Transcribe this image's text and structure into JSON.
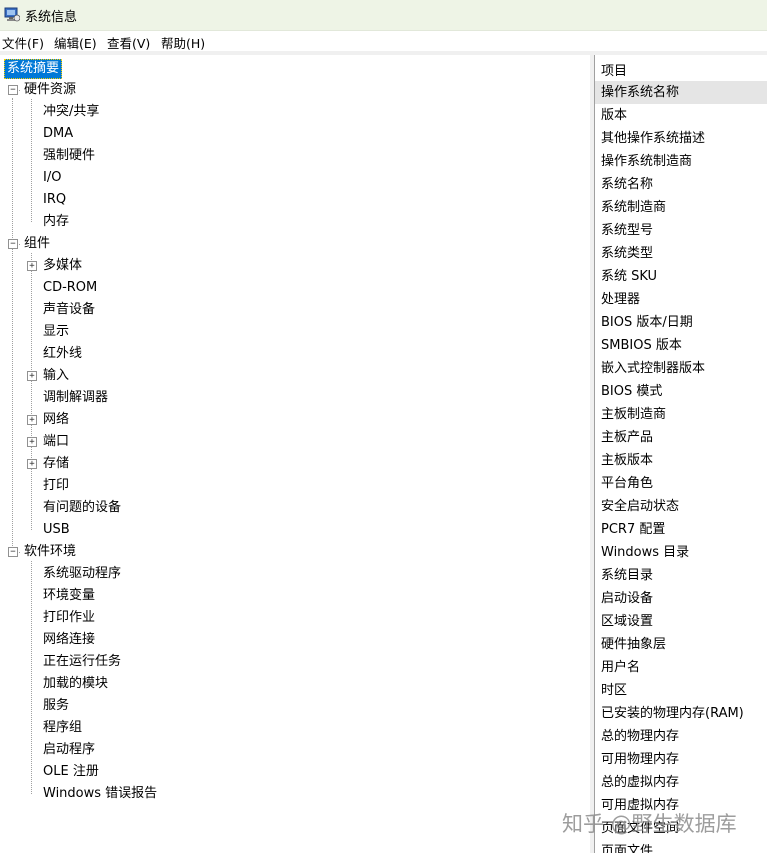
{
  "window": {
    "title": "系统信息",
    "icon": "system-info-icon"
  },
  "menu": [
    {
      "label": "文件(F)"
    },
    {
      "label": "编辑(E)"
    },
    {
      "label": "查看(V)"
    },
    {
      "label": "帮助(H)"
    }
  ],
  "tree": {
    "root": "系统摘要",
    "hardware": {
      "label": "硬件资源",
      "children": [
        "冲突/共享",
        "DMA",
        "强制硬件",
        "I/O",
        "IRQ",
        "内存"
      ]
    },
    "components": {
      "label": "组件",
      "children": [
        "多媒体",
        "CD-ROM",
        "声音设备",
        "显示",
        "红外线",
        "输入",
        "调制解调器",
        "网络",
        "端口",
        "存储",
        "打印",
        "有问题的设备",
        "USB"
      ]
    },
    "software": {
      "label": "软件环境",
      "children": [
        "系统驱动程序",
        "环境变量",
        "打印作业",
        "网络连接",
        "正在运行任务",
        "加载的模块",
        "服务",
        "程序组",
        "启动程序",
        "OLE 注册",
        "Windows 错误报告"
      ]
    }
  },
  "list": {
    "header": "项目",
    "items": [
      "操作系统名称",
      "版本",
      "其他操作系统描述",
      "操作系统制造商",
      "系统名称",
      "系统制造商",
      "系统型号",
      "系统类型",
      "系统 SKU",
      "处理器",
      "BIOS 版本/日期",
      "SMBIOS 版本",
      "嵌入式控制器版本",
      "BIOS 模式",
      "主板制造商",
      "主板产品",
      "主板版本",
      "平台角色",
      "安全启动状态",
      "PCR7 配置",
      "Windows 目录",
      "系统目录",
      "启动设备",
      "区域设置",
      "硬件抽象层",
      "用户名",
      "时区",
      "已安装的物理内存(RAM)",
      "总的物理内存",
      "可用物理内存",
      "总的虚拟内存",
      "可用虚拟内存",
      "页面文件空间",
      "页面文件"
    ]
  },
  "watermark": "知乎 @野生数据库",
  "colors": {
    "selection": "#0078d7",
    "titlebar": "#eef4e6",
    "row_highlight": "#e5e5e5"
  }
}
